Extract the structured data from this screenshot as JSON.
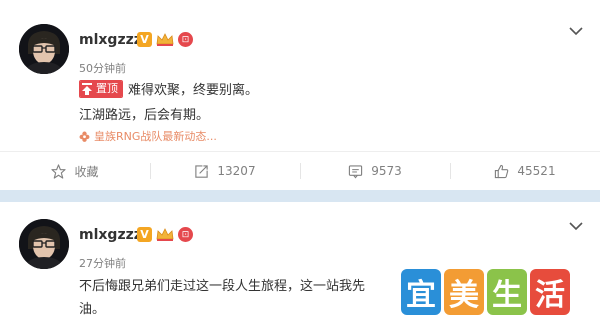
{
  "post1": {
    "username": "mlxgzzz",
    "verified_badge": "V",
    "level_badge": "⊡",
    "time": "50分钟前",
    "pin_label": "置顶",
    "line1": "难得欢聚，终要别离。",
    "line2": "江湖路远，后会有期。",
    "topic": "皇族RNG战队最新动态...",
    "actions": {
      "favorite": "收藏",
      "repost": "13207",
      "comment": "9573",
      "like": "45521"
    }
  },
  "post2": {
    "username": "mlxgzzz",
    "verified_badge": "V",
    "level_badge": "⊡",
    "time": "27分钟前",
    "line1": "不后悔跟兄弟们走过这一段人生旅程，这一站我先",
    "line2": "油。"
  },
  "watermark": {
    "chars": [
      "宜",
      "美",
      "生",
      "活"
    ],
    "colors": [
      "#2a8fd8",
      "#f39c34",
      "#8bc34a",
      "#e74c3c"
    ]
  },
  "colors": {
    "page_bg": "#d8e6f2",
    "accent_red": "#e5484d",
    "topic_orange": "#e88b66"
  }
}
